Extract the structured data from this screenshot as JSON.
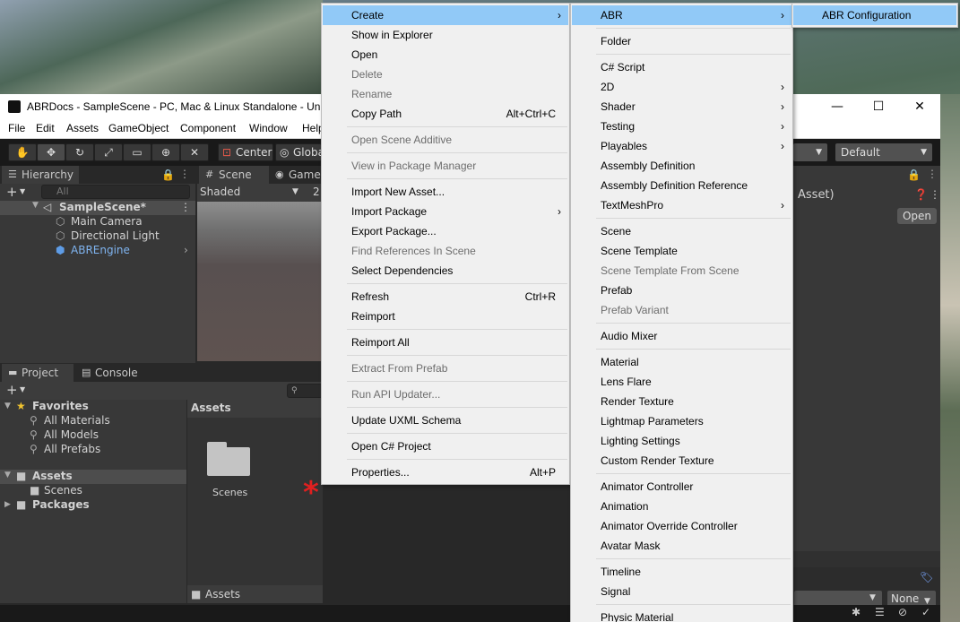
{
  "window": {
    "title": "ABRDocs - SampleScene - PC, Mac & Linux Standalone - Unity",
    "minimize": "—",
    "maximize": "☐",
    "close": "✕"
  },
  "menubar": [
    "File",
    "Edit",
    "Assets",
    "GameObject",
    "Component",
    "Window",
    "Help"
  ],
  "toolbar": {
    "pivot": "Center",
    "space": "Global",
    "layout_dropdown": "Default"
  },
  "hierarchy": {
    "tab": "Hierarchy",
    "search_placeholder": "All",
    "scene": "SampleScene*",
    "items": [
      "Main Camera",
      "Directional Light",
      "ABREngine"
    ]
  },
  "scene_view": {
    "tab_scene": "Scene",
    "tab_game": "Game",
    "shading": "Shaded",
    "mode_2d": "2"
  },
  "inspector": {
    "title_fragment": "Asset)",
    "open_button": "Open",
    "none_dropdown": "None"
  },
  "project": {
    "tab_project": "Project",
    "tab_console": "Console",
    "favorites_label": "Favorites",
    "favorites": [
      "All Materials",
      "All Models",
      "All Prefabs"
    ],
    "assets_label": "Assets",
    "assets_children": [
      "Scenes"
    ],
    "packages_label": "Packages",
    "breadcrumb": "Assets",
    "grid_items": [
      "Scenes"
    ],
    "footer_path": "Assets"
  },
  "context_menu": [
    {
      "label": "Create",
      "highlighted": true,
      "submenu": true
    },
    {
      "label": "Show in Explorer"
    },
    {
      "label": "Open"
    },
    {
      "label": "Delete",
      "disabled": true
    },
    {
      "label": "Rename",
      "disabled": true
    },
    {
      "label": "Copy Path",
      "shortcut": "Alt+Ctrl+C"
    },
    {
      "label": "Open Scene Additive",
      "disabled": true
    },
    {
      "label": "View in Package Manager",
      "disabled": true
    },
    {
      "label": "Import New Asset..."
    },
    {
      "label": "Import Package",
      "submenu": true
    },
    {
      "label": "Export Package..."
    },
    {
      "label": "Find References In Scene",
      "disabled": true
    },
    {
      "label": "Select Dependencies"
    },
    {
      "label": "Refresh",
      "shortcut": "Ctrl+R"
    },
    {
      "label": "Reimport"
    },
    {
      "label": "Reimport All"
    },
    {
      "label": "Extract From Prefab",
      "disabled": true
    },
    {
      "label": "Run API Updater...",
      "disabled": true
    },
    {
      "label": "Update UXML Schema"
    },
    {
      "label": "Open C# Project"
    },
    {
      "label": "Properties...",
      "shortcut": "Alt+P"
    }
  ],
  "create_menu": [
    {
      "label": "ABR",
      "highlighted": true,
      "submenu": true
    },
    {
      "label": "Folder"
    },
    {
      "label": "C# Script"
    },
    {
      "label": "2D",
      "submenu": true
    },
    {
      "label": "Shader",
      "submenu": true
    },
    {
      "label": "Testing",
      "submenu": true
    },
    {
      "label": "Playables",
      "submenu": true
    },
    {
      "label": "Assembly Definition"
    },
    {
      "label": "Assembly Definition Reference"
    },
    {
      "label": "TextMeshPro",
      "submenu": true
    },
    {
      "label": "Scene"
    },
    {
      "label": "Scene Template"
    },
    {
      "label": "Scene Template From Scene",
      "disabled": true
    },
    {
      "label": "Prefab"
    },
    {
      "label": "Prefab Variant",
      "disabled": true
    },
    {
      "label": "Audio Mixer"
    },
    {
      "label": "Material"
    },
    {
      "label": "Lens Flare"
    },
    {
      "label": "Render Texture"
    },
    {
      "label": "Lightmap Parameters"
    },
    {
      "label": "Lighting Settings"
    },
    {
      "label": "Custom Render Texture"
    },
    {
      "label": "Animator Controller"
    },
    {
      "label": "Animation"
    },
    {
      "label": "Animator Override Controller"
    },
    {
      "label": "Avatar Mask"
    },
    {
      "label": "Timeline"
    },
    {
      "label": "Signal"
    },
    {
      "label": "Physic Material"
    }
  ],
  "abr_menu": [
    {
      "label": "ABR Configuration",
      "highlighted": true
    }
  ],
  "colors": {
    "menu_highlight": "#91c9f7",
    "unity_dark": "#383838",
    "selection_blue": "#5e9ce6",
    "annotation_red": "#e02020"
  }
}
